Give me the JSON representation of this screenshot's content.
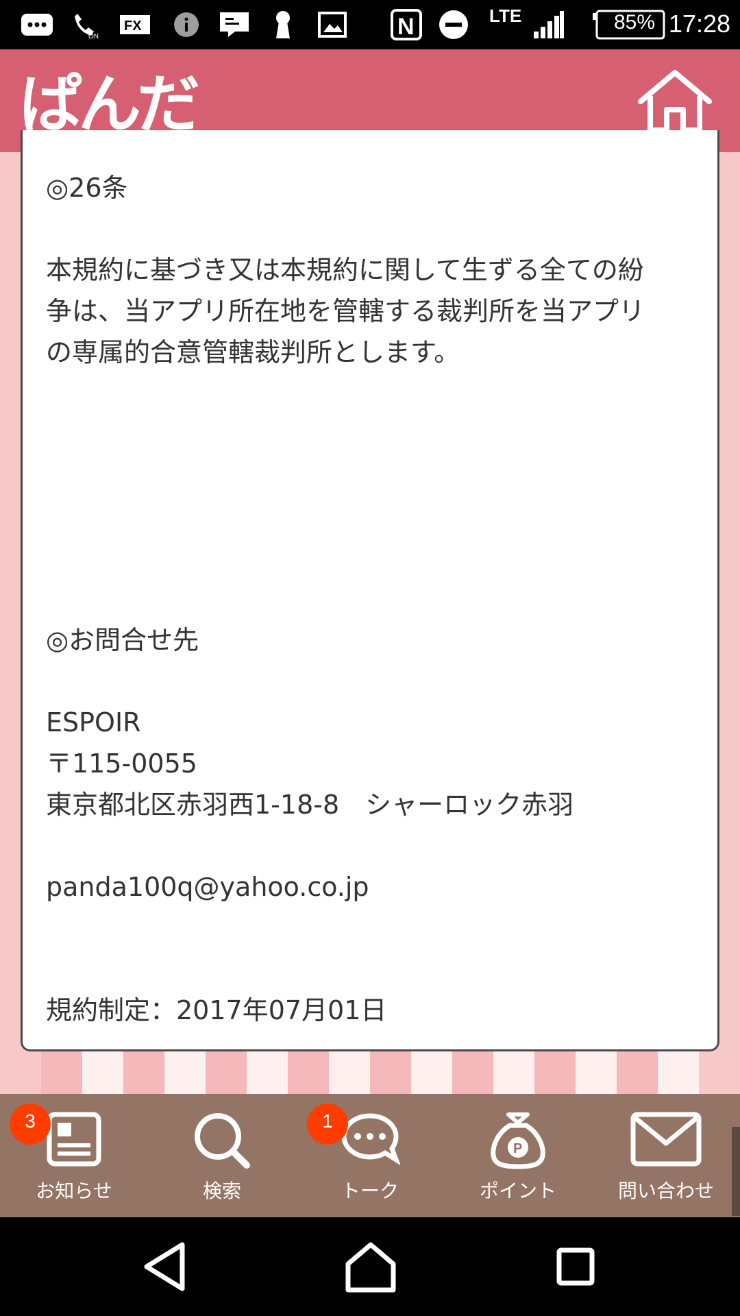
{
  "status_bar": {
    "nfc_label": "N",
    "network": "LTE",
    "battery": "85%",
    "time": "17:28",
    "icons": [
      "message-icon",
      "wifi-calling-icon",
      "fx-icon",
      "info-icon",
      "notification-icon",
      "keyhole-icon",
      "image-icon",
      "nfc-icon",
      "do-not-disturb-icon",
      "signal-icon",
      "battery-icon"
    ]
  },
  "header": {
    "logo_text": "ぱんだ",
    "home_icon": "home-icon"
  },
  "content": {
    "article_heading": "◎26条",
    "article_text_lines": [
      "本規約に基づき又は本規約に関して生ずる全ての紛",
      "争は、当アプリ所在地を管轄する裁判所を当アプリ",
      "の専属的合意管轄裁判所とします。"
    ],
    "contact_heading": "◎お問合せ先",
    "company": "ESPOIR",
    "postal": "〒115-0055",
    "address": "東京都北区赤羽西1-18-8　シャーロック赤羽",
    "email": "panda100q@yahoo.co.jp",
    "enactment": "規約制定：2017年07月01日"
  },
  "bottom_nav": {
    "items": [
      {
        "label": "お知らせ",
        "icon": "news-icon",
        "badge": "3"
      },
      {
        "label": "検索",
        "icon": "search-icon",
        "badge": ""
      },
      {
        "label": "トーク",
        "icon": "chat-icon",
        "badge": "1"
      },
      {
        "label": "ポイント",
        "icon": "point-bag-icon",
        "badge": ""
      },
      {
        "label": "問い合わせ",
        "icon": "mail-icon",
        "badge": ""
      }
    ]
  },
  "colors": {
    "header": "#d65f72",
    "nav_bg": "#947464",
    "badge": "#ff3d00",
    "stripe_pink": "#f5b8bb",
    "stripe_light": "#fdf0ef"
  }
}
